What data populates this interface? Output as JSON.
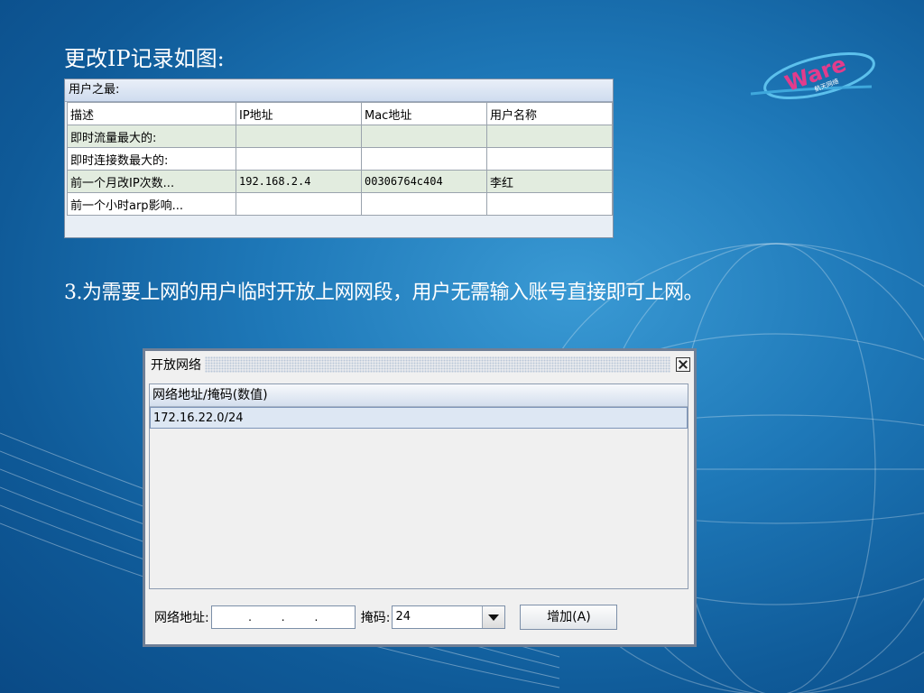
{
  "slide": {
    "heading1": "更改IP记录如图:",
    "heading2": "3.为需要上网的用户临时开放上网网段，用户无需输入账号直接即可上网。"
  },
  "logo": {
    "text": "Ware",
    "subtext": "航天网络"
  },
  "user_stats": {
    "title": "用户之最:",
    "columns": [
      "描述",
      "IP地址",
      "Mac地址",
      "用户名称"
    ],
    "rows": [
      [
        "即时流量最大的:",
        "",
        "",
        ""
      ],
      [
        "即时连接数最大的:",
        "",
        "",
        ""
      ],
      [
        "前一个月改IP次数...",
        "192.168.2.4",
        "00306764c404",
        "李红"
      ],
      [
        "前一个小时arp影响...",
        "",
        "",
        ""
      ]
    ]
  },
  "dialog": {
    "title": "开放网络",
    "list_header": "网络地址/掩码(数值)",
    "list_items": [
      "172.16.22.0/24"
    ],
    "network_label": "网络地址:",
    "ip_dots": [
      ".",
      ".",
      "."
    ],
    "mask_label": "掩码:",
    "mask_value": "24",
    "add_button": "增加(A)"
  },
  "colors": {
    "background": "#1e78b8",
    "text": "#ffffff"
  }
}
